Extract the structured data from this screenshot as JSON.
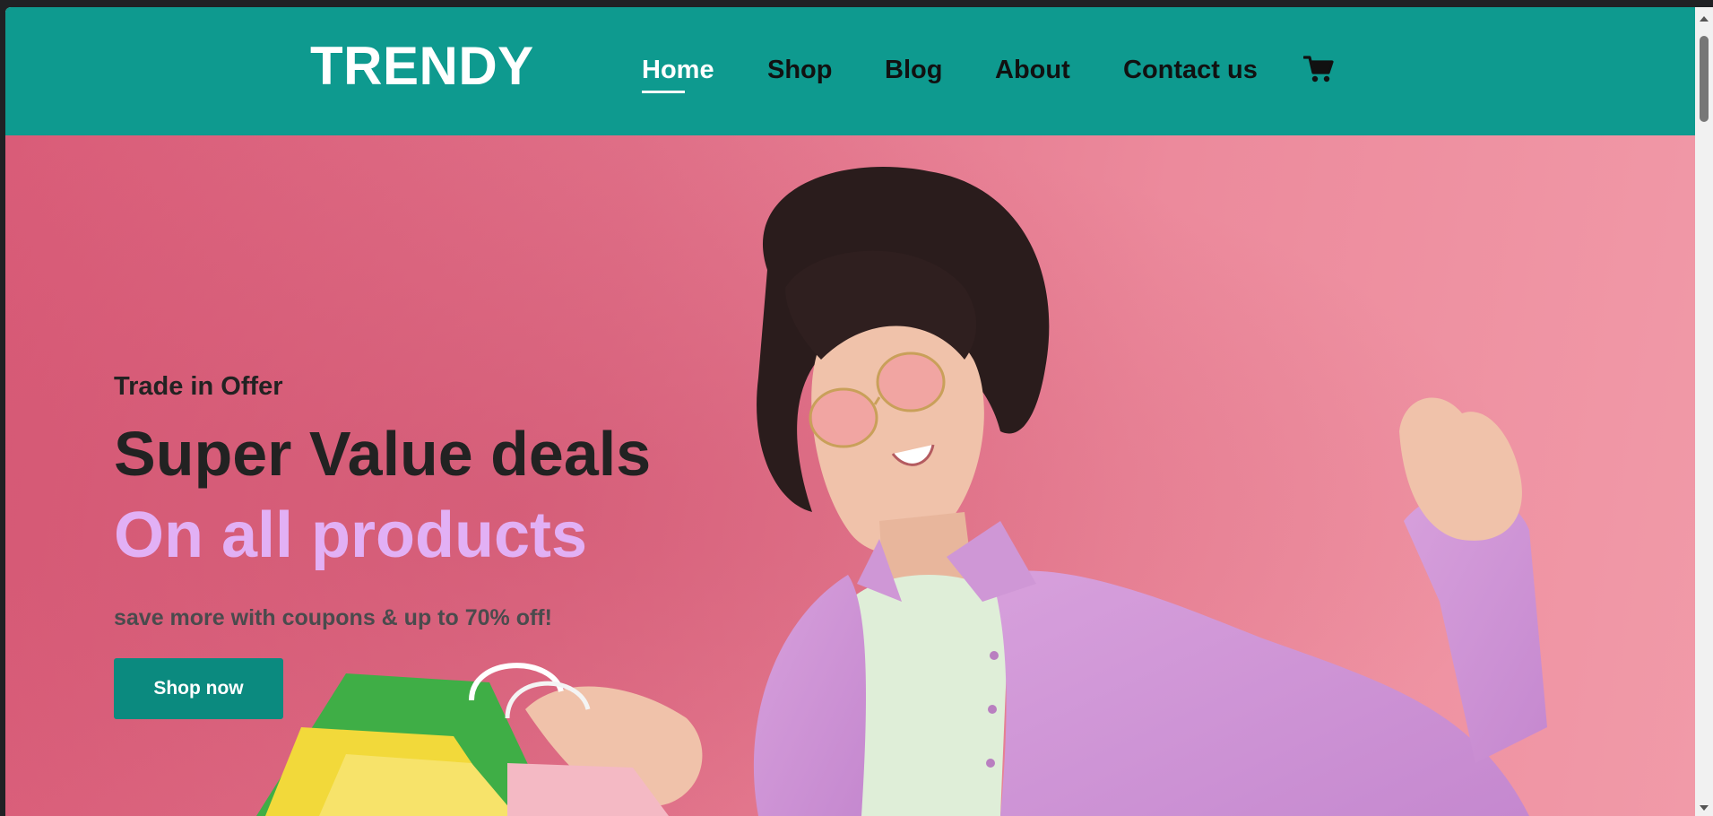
{
  "brand": {
    "logo": "TRENDY"
  },
  "nav": {
    "items": [
      {
        "label": "Home",
        "active": true
      },
      {
        "label": "Shop",
        "active": false
      },
      {
        "label": "Blog",
        "active": false
      },
      {
        "label": "About",
        "active": false
      },
      {
        "label": "Contact us",
        "active": false
      }
    ],
    "cart_icon": "shopping-cart-icon"
  },
  "hero": {
    "kicker": "Trade in Offer",
    "headline": "Super Value deals",
    "subhead": "On all products",
    "tagline": "save more with coupons & up to 70% off!",
    "cta_label": "Shop now",
    "image": "woman-with-shopping-bags-photo"
  },
  "colors": {
    "header_bg": "#0e9a8f",
    "hero_bg": "#e07088",
    "accent_purple": "#e2b0f5",
    "cta_bg": "#0b8a7f"
  }
}
